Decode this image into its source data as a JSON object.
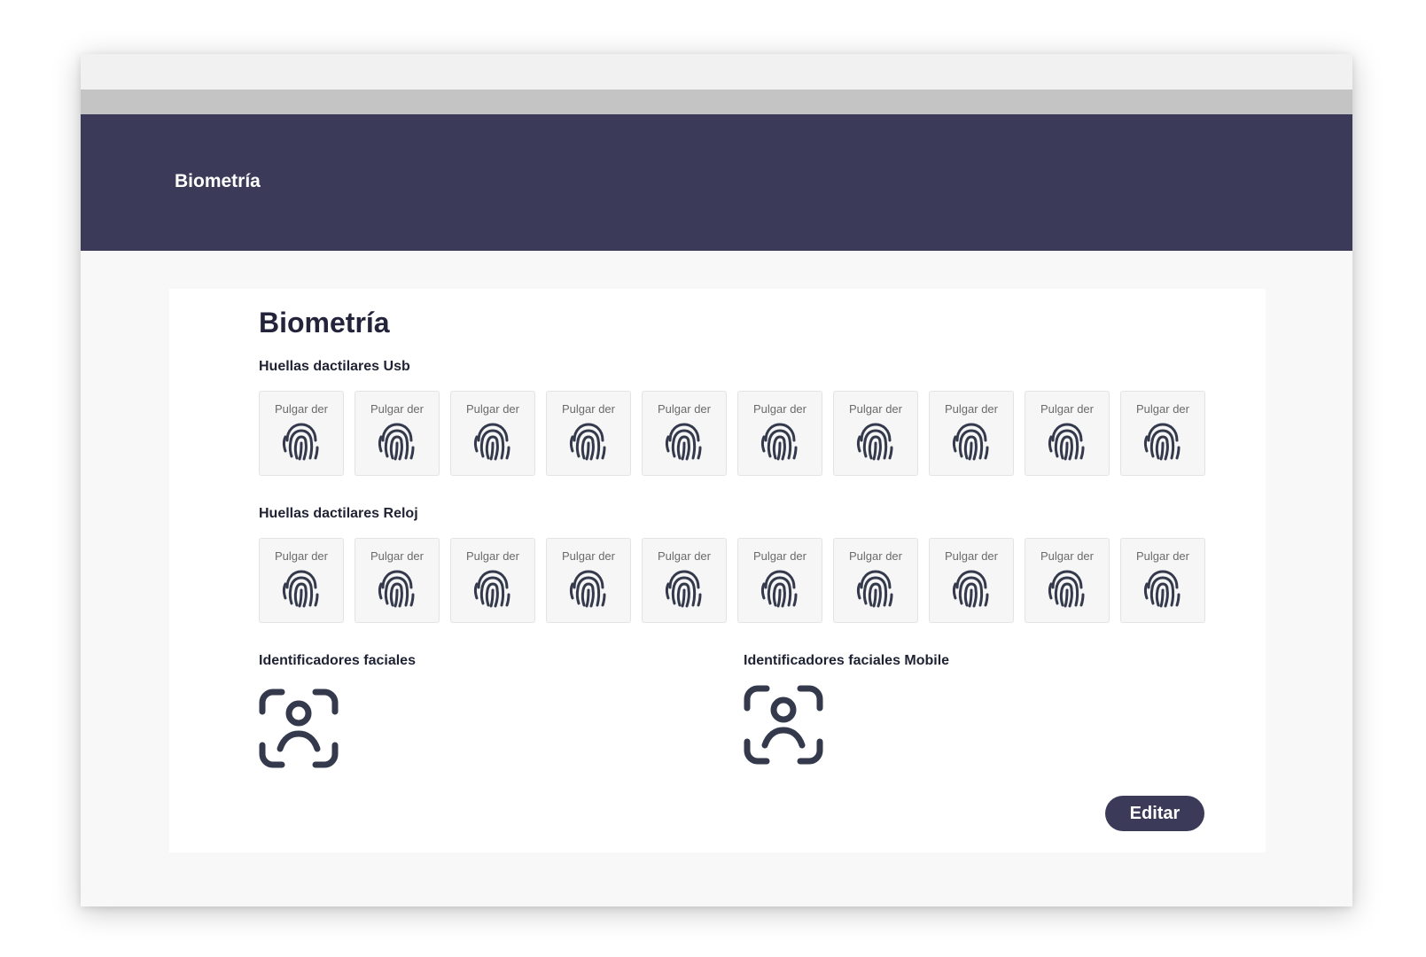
{
  "header": {
    "title": "Biometría"
  },
  "main": {
    "title": "Biometría",
    "usb_section": {
      "label": "Huellas dactilares Usb",
      "fingers": [
        "Pulgar der",
        "Pulgar der",
        "Pulgar der",
        "Pulgar der",
        "Pulgar der",
        "Pulgar der",
        "Pulgar der",
        "Pulgar der",
        "Pulgar der",
        "Pulgar der"
      ]
    },
    "watch_section": {
      "label": "Huellas dactilares Reloj",
      "fingers": [
        "Pulgar der",
        "Pulgar der",
        "Pulgar der",
        "Pulgar der",
        "Pulgar der",
        "Pulgar der",
        "Pulgar der",
        "Pulgar der",
        "Pulgar der",
        "Pulgar der"
      ]
    },
    "face_section": {
      "label": "Identificadores faciales",
      "icon": "face-scan-icon"
    },
    "face_mobile_section": {
      "label": "Identificadores faciales Mobile",
      "icon": "face-scan-icon"
    },
    "edit_label": "Editar"
  },
  "colors": {
    "header_bg": "#3b3b59",
    "icon": "#343a4c",
    "button_bg": "#3b3b59"
  },
  "icons": {
    "fingerprint": "fingerprint-icon"
  }
}
